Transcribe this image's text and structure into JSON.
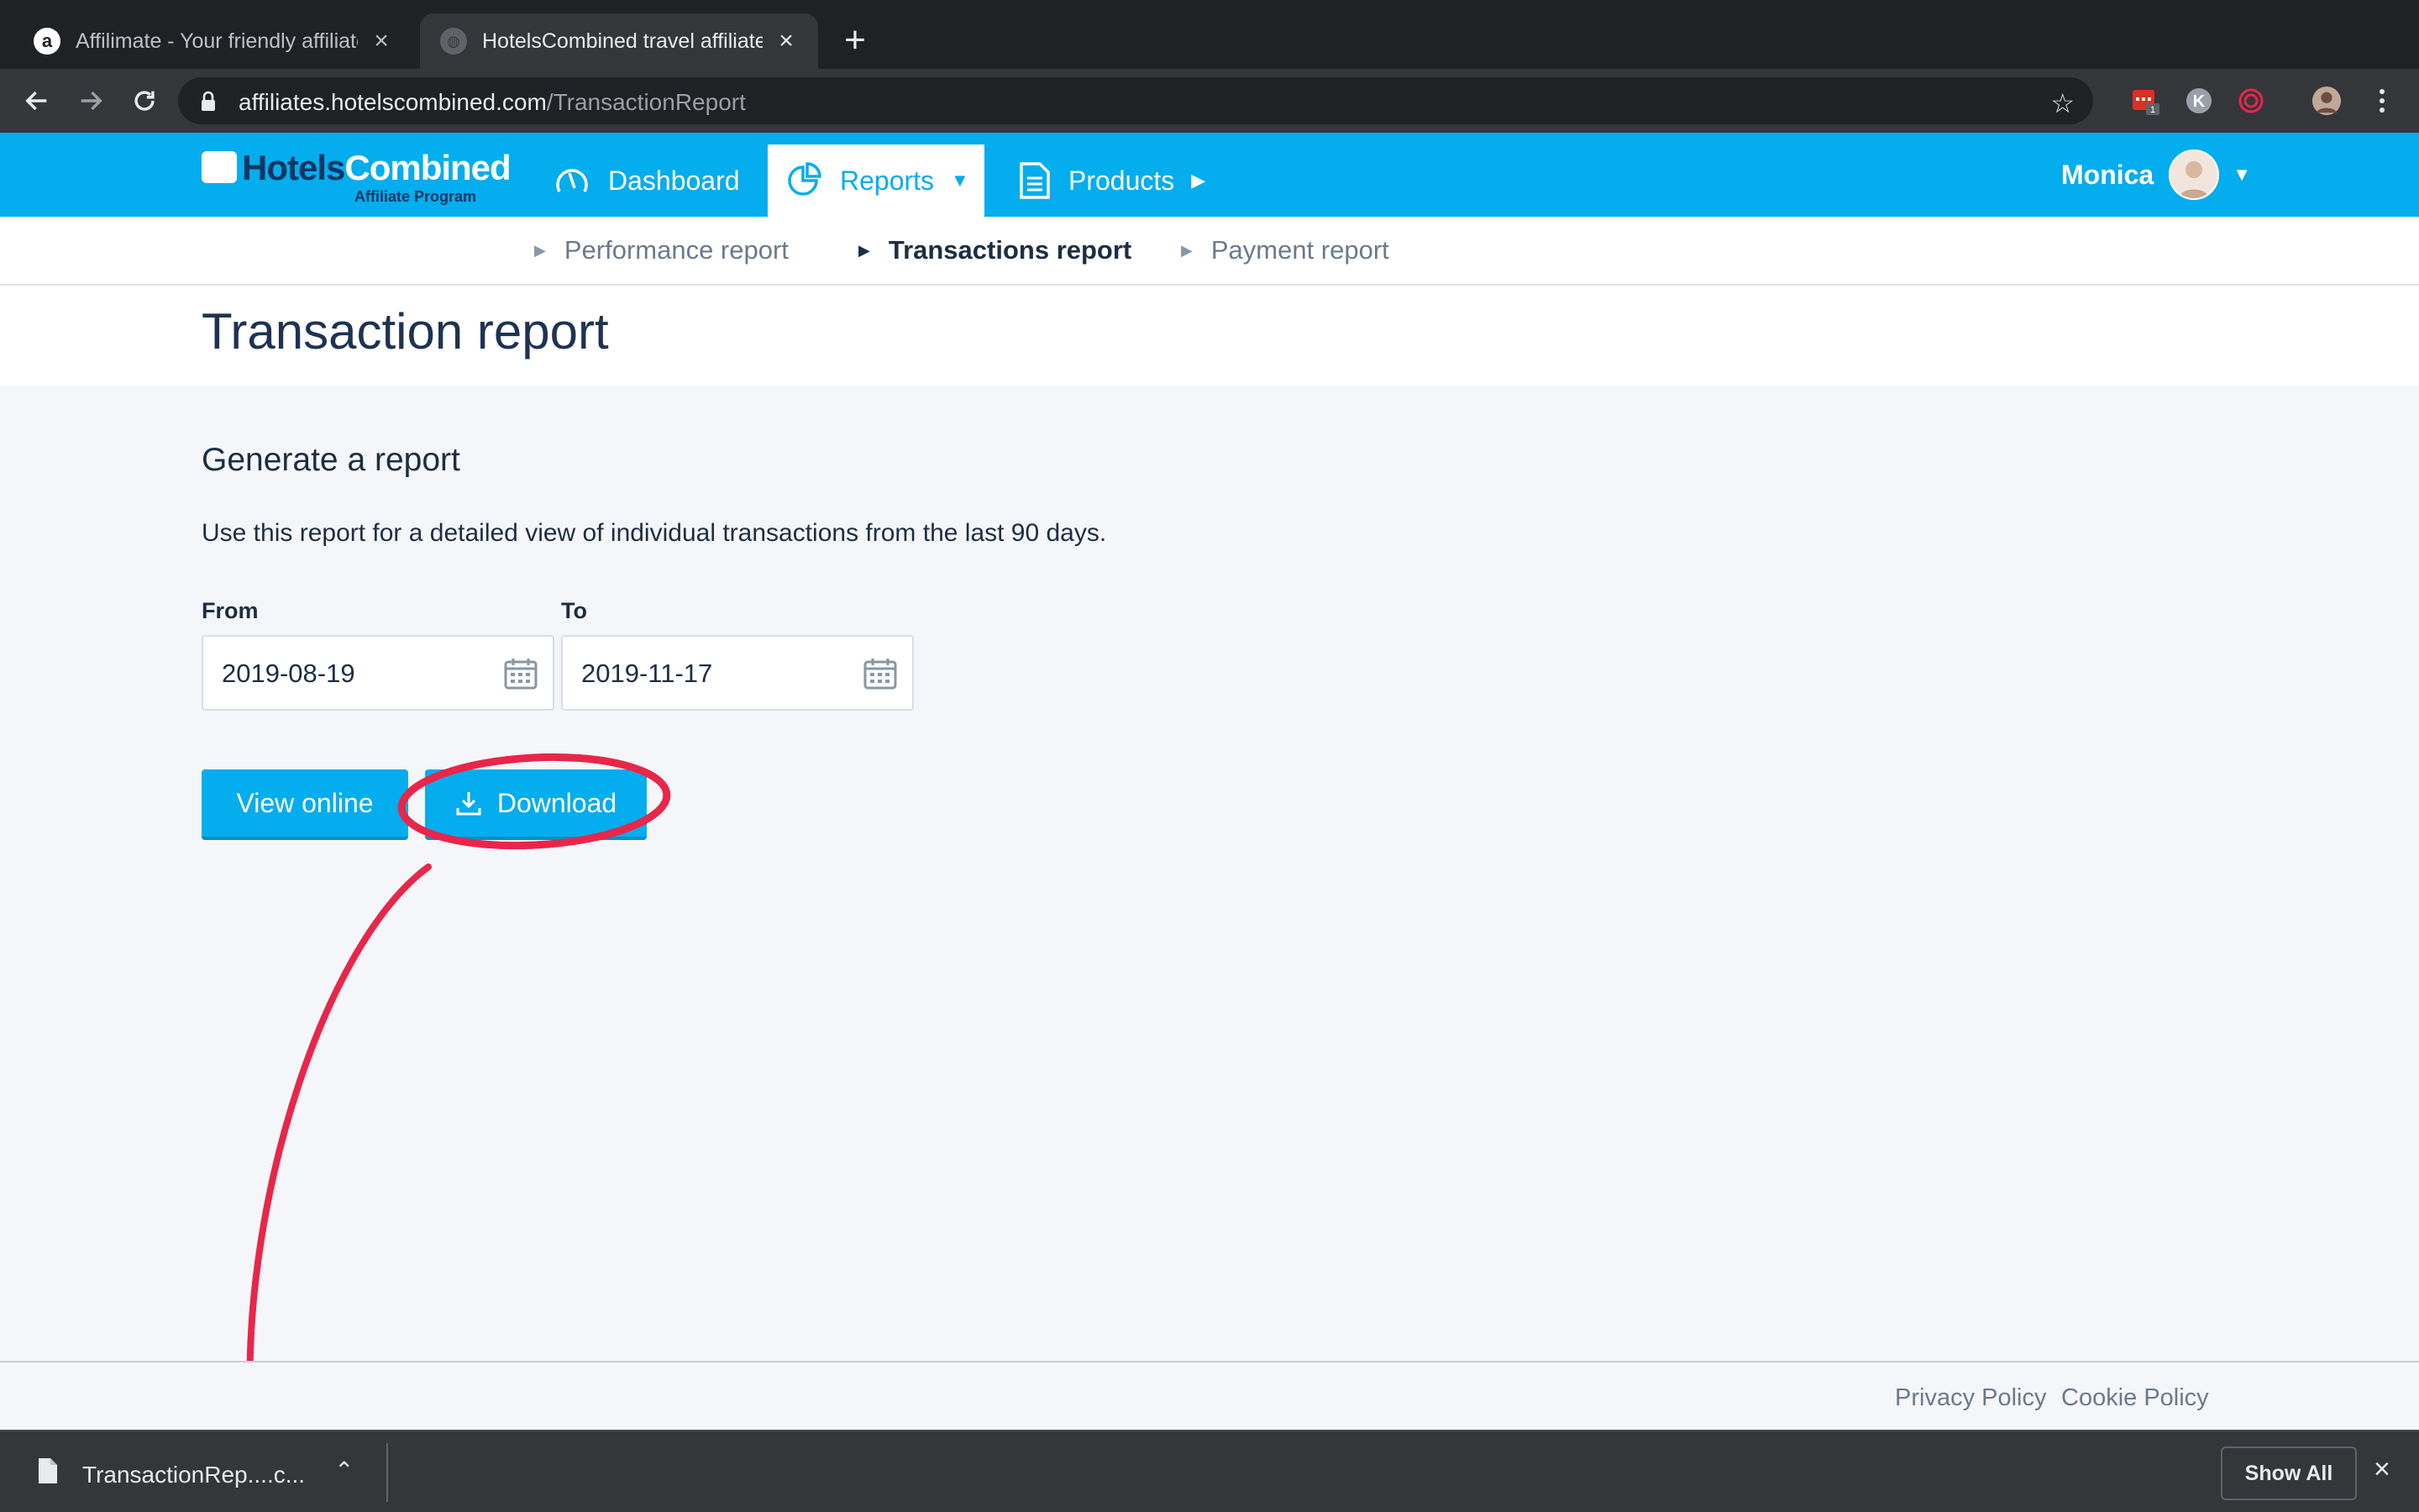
{
  "browser": {
    "tabs": [
      {
        "title": "Affilimate - Your friendly affiliate",
        "favicon": "a"
      },
      {
        "title": "HotelsCombined travel affiliate"
      }
    ],
    "url_host": "affiliates.hotelscombined.com",
    "url_path": "/TransactionReport"
  },
  "header": {
    "logo_word_a": "Hotels",
    "logo_word_b": "Combined",
    "logo_sub": "Affiliate Program",
    "nav": [
      {
        "label": "Dashboard",
        "icon": "gauge-icon"
      },
      {
        "label": "Reports",
        "icon": "pie-chart-icon",
        "active": true
      },
      {
        "label": "Products",
        "icon": "document-icon"
      }
    ],
    "user_name": "Monica"
  },
  "subnav": {
    "items": [
      {
        "label": "Performance report"
      },
      {
        "label": "Transactions report",
        "active": true
      },
      {
        "label": "Payment report"
      }
    ]
  },
  "page": {
    "title": "Transaction report",
    "section_title": "Generate a report",
    "description": "Use this report for a detailed view of individual transactions from the last 90 days.",
    "from_label": "From",
    "from_value": "2019-08-19",
    "to_label": "To",
    "to_value": "2019-11-17",
    "view_online_label": "View online",
    "download_label": "Download"
  },
  "footer": {
    "privacy": "Privacy Policy",
    "cookie": "Cookie Policy"
  },
  "download_shelf": {
    "filename": "TransactionRep....c...",
    "show_all": "Show All"
  },
  "colors": {
    "brand": "#04adee",
    "navy": "#1e3352",
    "annotation": "#e8264a"
  }
}
